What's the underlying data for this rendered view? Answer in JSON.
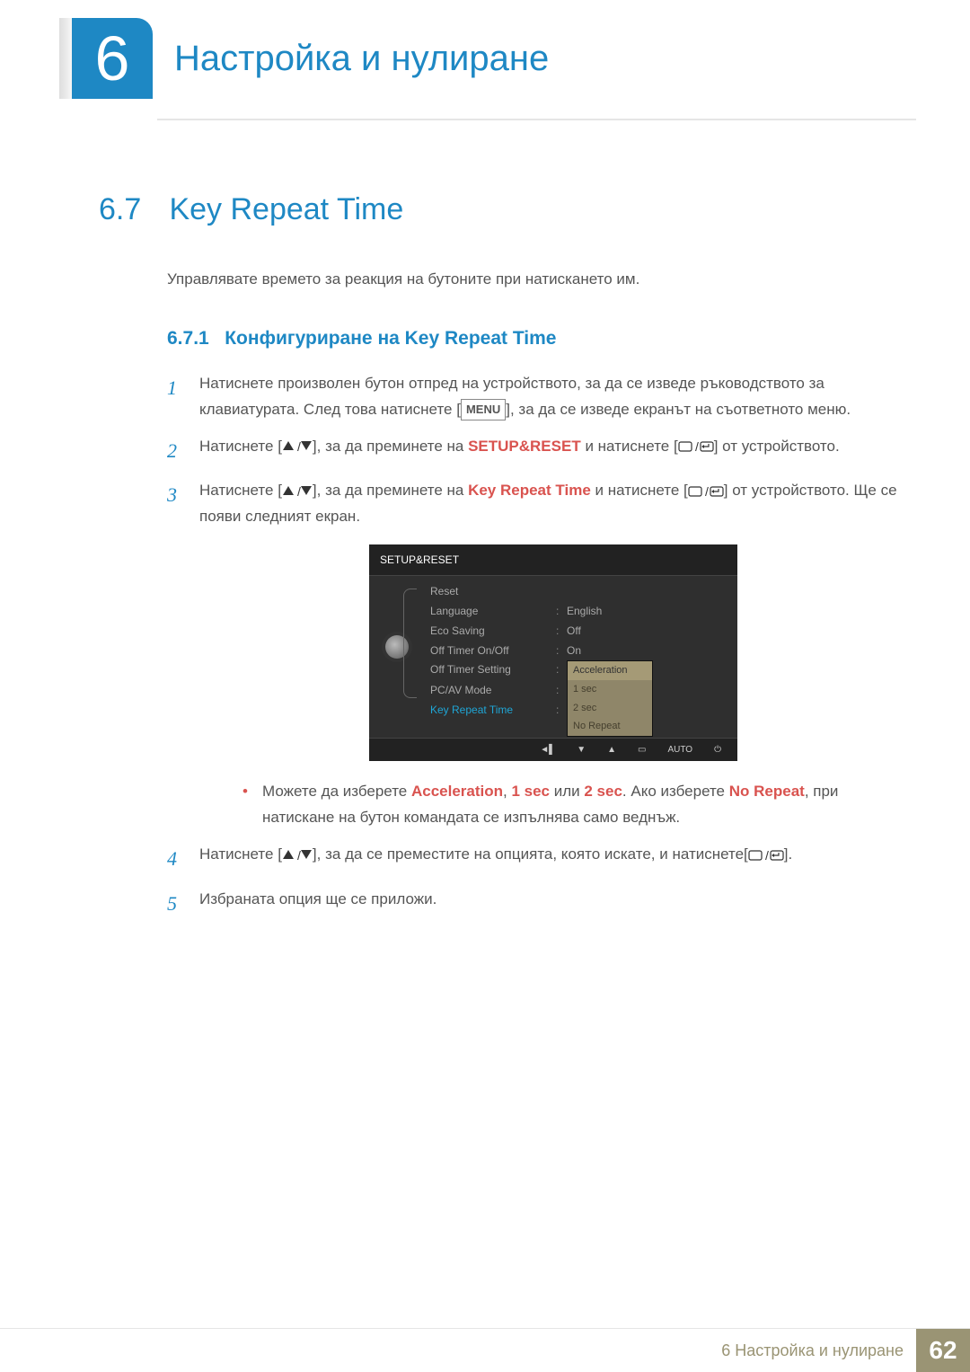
{
  "chapter": {
    "number": "6",
    "title": "Настройка и нулиране"
  },
  "section": {
    "number": "6.7",
    "title": "Key Repeat Time"
  },
  "intro": "Управлявате времето за реакция на бутоните при натискането им.",
  "subsection": {
    "number": "6.7.1",
    "title": "Конфигуриране на Key Repeat Time"
  },
  "steps": {
    "s1a": "Натиснете произволен бутон отпред на устройството, за да се изведе ръководството за клавиатурата. След това натиснете [",
    "s1_menu": "MENU",
    "s1b": "], за да се изведе екранът на съответното меню.",
    "s2a": "Натиснете [",
    "s2b": "], за да преминете на ",
    "s2_hl": "SETUP&RESET",
    "s2c": " и натиснете [",
    "s2d": "] от устройството.",
    "s3a": "Натиснете [",
    "s3b": "], за да преминете на ",
    "s3_hl": "Key Repeat Time",
    "s3c": " и натиснете [",
    "s3d": "] от устройството. Ще се появи следният екран.",
    "bullet_a": "Можете да изберете ",
    "opt1": "Acceleration",
    "comma1": ", ",
    "opt2": "1 sec",
    "or": " или ",
    "opt3": "2 sec",
    "period": ". Ако изберете ",
    "opt4": "No Repeat",
    "bullet_b": ", при натискане на бутон командата се изпълнява само веднъж.",
    "s4a": "Натиснете [",
    "s4b": "], за да се преместите на опцията, която искате, и натиснете[",
    "s4c": "].",
    "s5": "Избраната опция ще се приложи."
  },
  "osd": {
    "title": "SETUP&RESET",
    "rows": [
      {
        "label": "Reset",
        "value": ""
      },
      {
        "label": "Language",
        "value": "English"
      },
      {
        "label": "Eco Saving",
        "value": "Off"
      },
      {
        "label": "Off Timer On/Off",
        "value": "On"
      },
      {
        "label": "Off Timer Setting",
        "value": ""
      },
      {
        "label": "PC/AV Mode",
        "value": ""
      },
      {
        "label": "Key Repeat Time",
        "value": ""
      }
    ],
    "dropdown": [
      "Acceleration",
      "1 sec",
      "2 sec",
      "No Repeat"
    ],
    "auto": "AUTO"
  },
  "footer": {
    "text": "6 Настройка и нулиране",
    "page": "62"
  }
}
